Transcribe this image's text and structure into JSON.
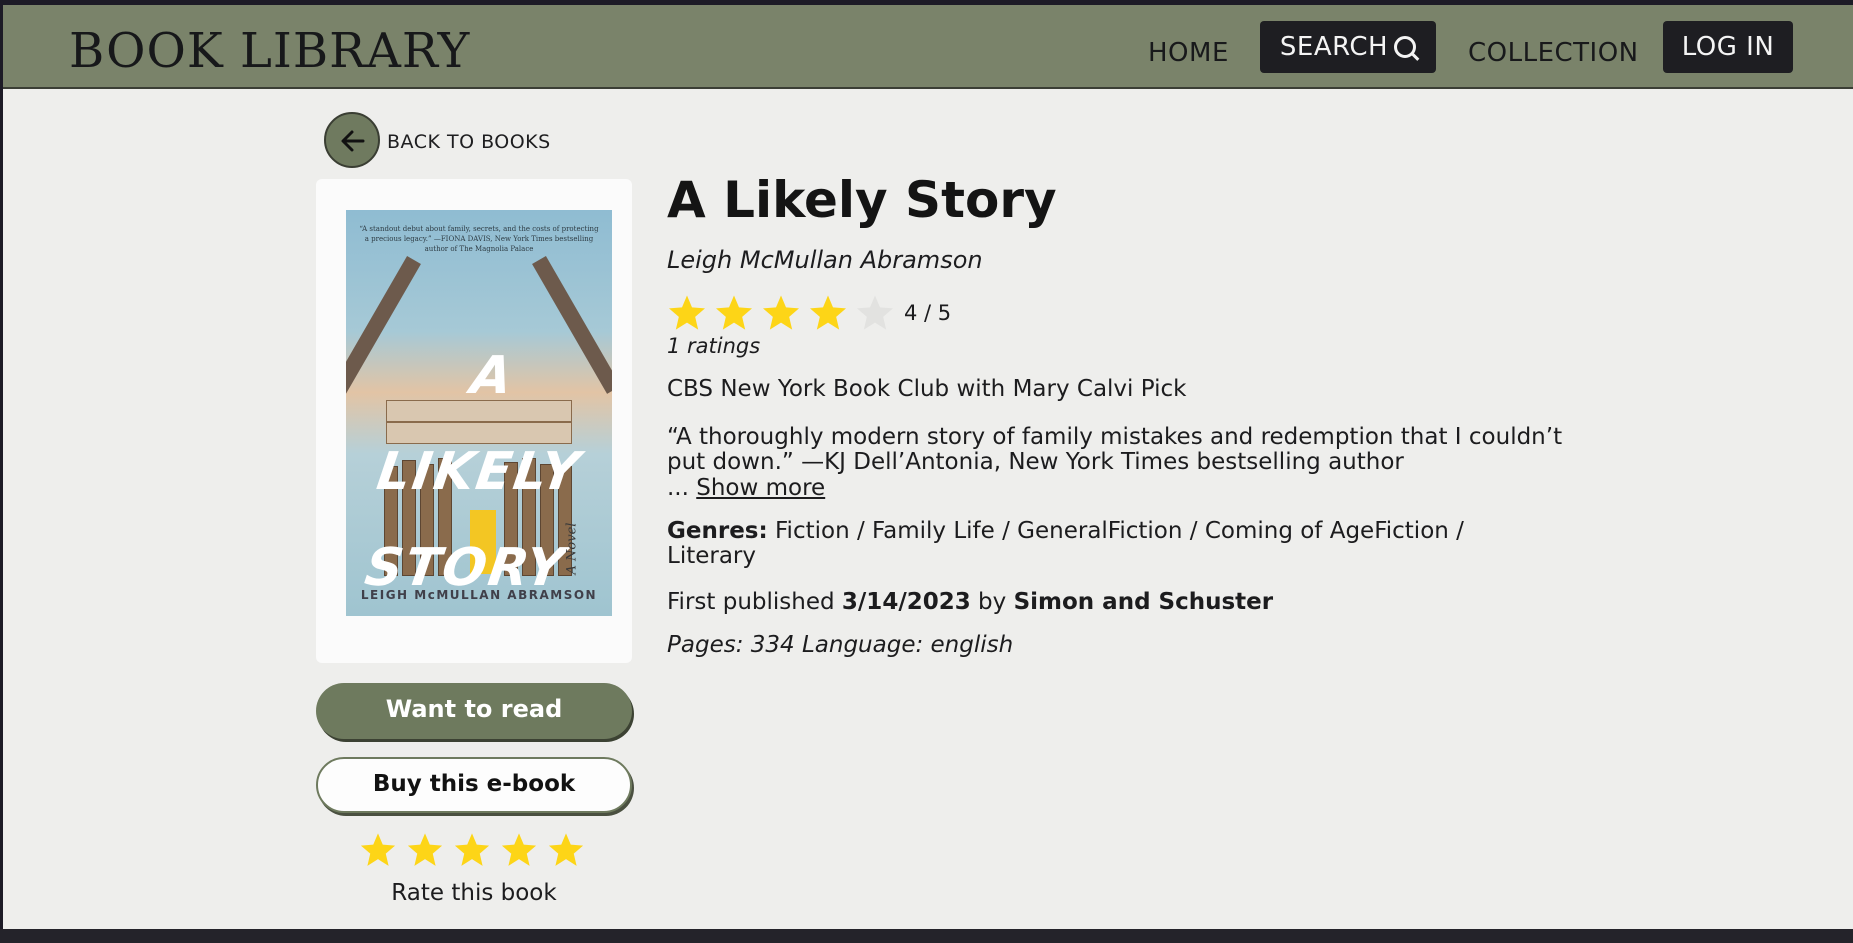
{
  "header": {
    "logo": "BOOK LIBRARY",
    "nav": {
      "home": "HOME",
      "search": "SEARCH",
      "collection": "COLLECTION",
      "login": "LOG IN"
    }
  },
  "back": {
    "label": "BACK TO BOOKS",
    "icon": "arrow-left-icon"
  },
  "book": {
    "cover": {
      "title_art": "A LIKELY STORY",
      "author_art": "LEIGH McMULLAN ABRAMSON",
      "blurb": "“A standout debut about family, secrets, and the costs of protecting a precious legacy.” —FIONA DAVIS, New York Times bestselling author of The Magnolia Palace",
      "subtitle_art": "A Novel"
    },
    "title": "A Likely Story",
    "author": "Leigh McMullan Abramson",
    "rating": {
      "value": 4,
      "max": 5,
      "display": "4 / 5"
    },
    "ratings_count": "1 ratings",
    "club_pick": "CBS New York Book Club with Mary Calvi Pick",
    "quote_line1": "“A thoroughly modern story of family mistakes and redemption that I couldn’t",
    "quote_line2": "put down.” —KJ Dell’Antonia, New York Times bestselling author",
    "ellipsis": "...",
    "show_more": "Show more",
    "genres_label": "Genres:",
    "genres_value": "Fiction / Family Life / GeneralFiction / Coming of AgeFiction / Literary",
    "published_prefix": "First published",
    "published_date": "3/14/2023",
    "published_by": "by",
    "publisher": "Simon and Schuster",
    "pages_language": "Pages: 334 Language: english"
  },
  "actions": {
    "want_to_read": "Want to read",
    "buy_ebook": "Buy this e-book",
    "rate_label": "Rate this book",
    "rate_stars": 5
  },
  "colors": {
    "header_bg": "#7a836a",
    "accent_green": "#6e7a5e",
    "star_filled": "#fdd517",
    "star_empty": "#e2e2e0",
    "page_bg": "#eeeeec"
  }
}
